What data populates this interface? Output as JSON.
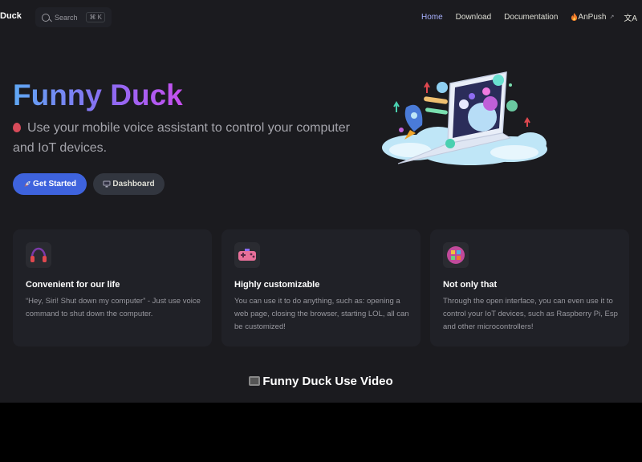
{
  "nav": {
    "brand": "Duck",
    "search_label": "Search",
    "search_shortcut": "⌘ K",
    "links": [
      {
        "label": "Home",
        "active": true
      },
      {
        "label": "Download",
        "active": false
      },
      {
        "label": "Documentation",
        "active": false
      },
      {
        "label": "AnPush",
        "active": false,
        "external": true
      }
    ],
    "translate_glyph": "文A"
  },
  "hero": {
    "title": "Funny Duck",
    "tagline": "Use your mobile voice assistant to control your computer and IoT devices.",
    "primary_button": "Get Started",
    "secondary_button": "Dashboard"
  },
  "features": [
    {
      "title": "Convenient for our life",
      "text": "“Hey, Siri! Shut down my computer” - Just use voice command to shut down the computer.",
      "icon": "headphones-icon"
    },
    {
      "title": "Highly customizable",
      "text": "You can use it to do anything, such as: opening a web page, closing the browser, starting LOL, all can be customized!",
      "icon": "gamepad-icon"
    },
    {
      "title": "Not only that",
      "text": "Through the open interface, you can even use it to control your IoT devices, such as Raspberry Pi, Esp and other microcontrollers!",
      "icon": "palette-icon"
    }
  ],
  "video_section": {
    "title": "Funny Duck Use Video"
  },
  "colors": {
    "page_bg": "#1b1b1f",
    "card_bg": "#202127",
    "accent": "#3e63dd",
    "active_link": "#a8b1ff",
    "gradient": [
      "#5fa8f4",
      "#c84ff0"
    ]
  }
}
